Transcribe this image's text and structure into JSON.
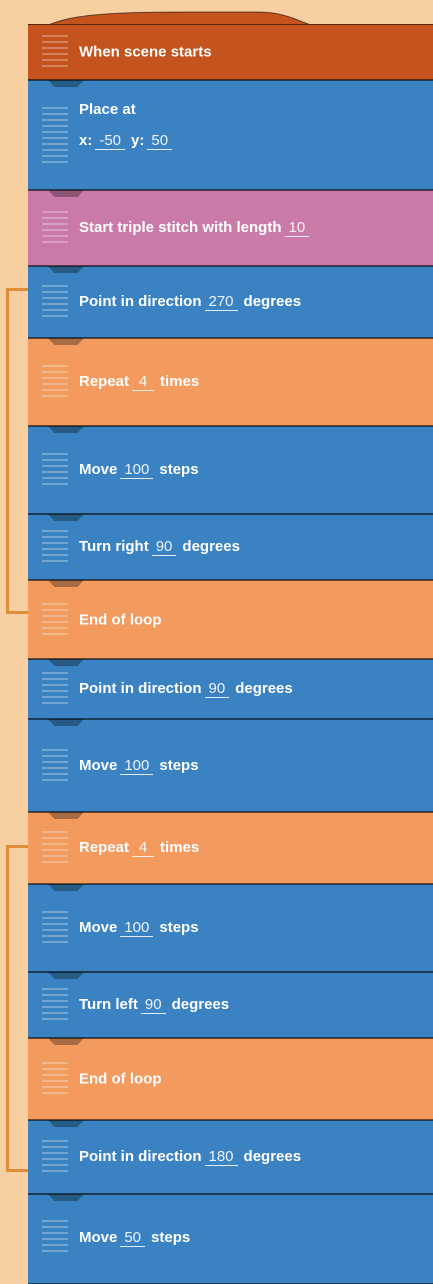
{
  "colors": {
    "background": "#f7cfa1",
    "motion_blue": "#3a82c1",
    "control_orange": "#f39a5f",
    "event_rust": "#c4531e",
    "stitch_pink": "#c97aa6",
    "loop_bracket": "#e08d3a"
  },
  "blocks": [
    {
      "type": "event",
      "label": "When scene starts"
    },
    {
      "type": "motion",
      "label": "Place at",
      "x_label": "x:",
      "x": "-50",
      "y_label": "y:",
      "y": "50"
    },
    {
      "type": "stitch",
      "label": "Start triple stitch with length",
      "value": "10"
    },
    {
      "type": "motion",
      "label": "Point in direction",
      "value": "270",
      "suffix": "degrees"
    },
    {
      "type": "control",
      "label": "Repeat",
      "value": "4",
      "suffix": "times"
    },
    {
      "type": "motion",
      "label": "Move",
      "value": "100",
      "suffix": "steps"
    },
    {
      "type": "motion",
      "label": "Turn right",
      "value": "90",
      "suffix": "degrees"
    },
    {
      "type": "control",
      "label": "End of loop"
    },
    {
      "type": "motion",
      "label": "Point in direction",
      "value": "90",
      "suffix": "degrees"
    },
    {
      "type": "motion",
      "label": "Move",
      "value": "100",
      "suffix": "steps"
    },
    {
      "type": "control",
      "label": "Repeat",
      "value": "4",
      "suffix": "times"
    },
    {
      "type": "motion",
      "label": "Move",
      "value": "100",
      "suffix": "steps"
    },
    {
      "type": "motion",
      "label": "Turn left",
      "value": "90",
      "suffix": "degrees"
    },
    {
      "type": "control",
      "label": "End of loop"
    },
    {
      "type": "motion",
      "label": "Point in direction",
      "value": "180",
      "suffix": "degrees"
    },
    {
      "type": "motion",
      "label": "Move",
      "value": "50",
      "suffix": "steps"
    }
  ]
}
